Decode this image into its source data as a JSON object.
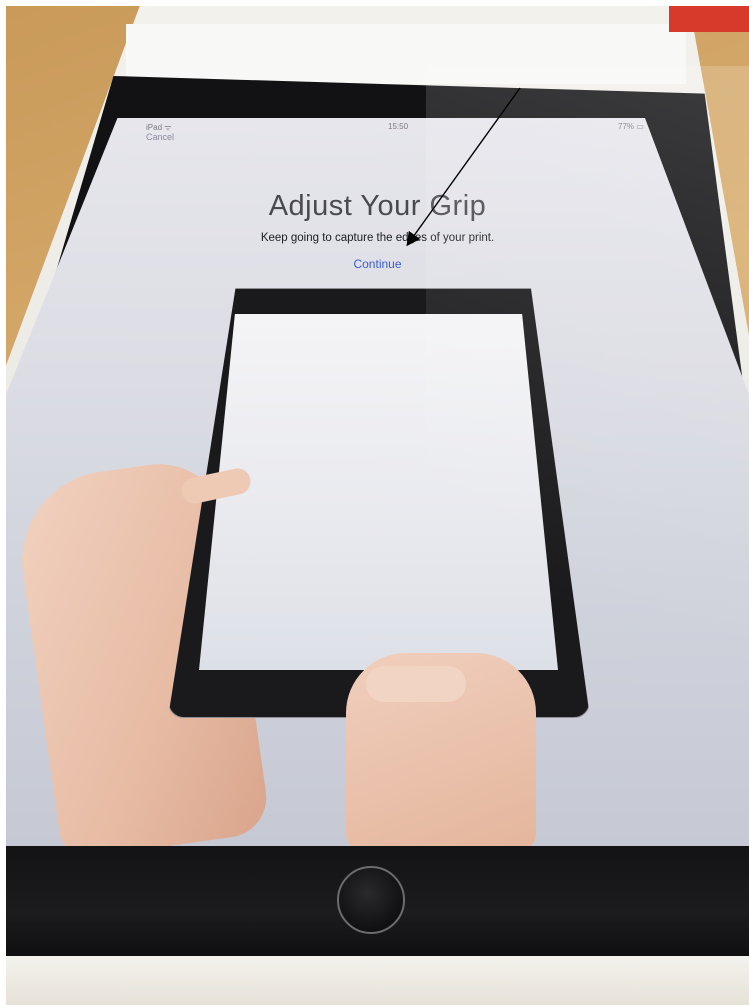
{
  "status_bar": {
    "carrier": "iPad ᯤ",
    "time": "15:50",
    "battery": "77% ▭"
  },
  "nav": {
    "cancel_label": "Cancel"
  },
  "setup": {
    "title": "Adjust Your Grip",
    "subtitle": "Keep going to capture the edges of your print.",
    "continue_label": "Continue"
  },
  "icons": {
    "home_button": "home-button-icon",
    "arrow": "annotation-arrow-icon"
  },
  "colors": {
    "accent": "#3d5ccf",
    "bezel": "#121214",
    "screen_bg": "#dcdde4"
  }
}
